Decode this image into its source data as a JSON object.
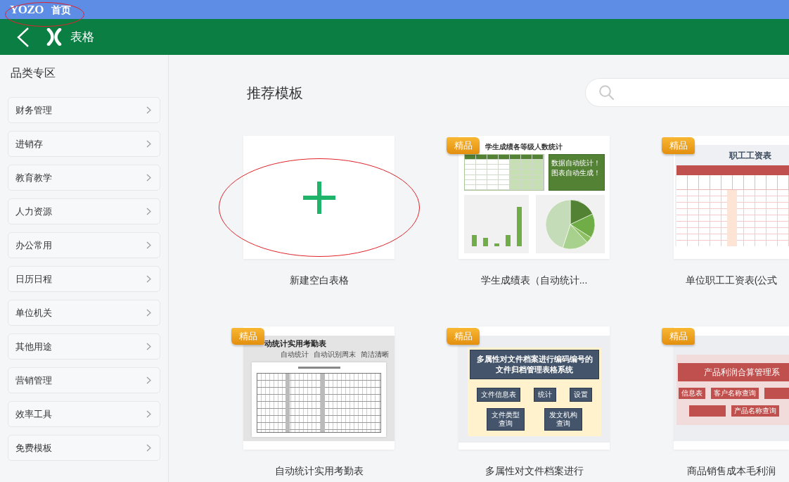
{
  "top_bar": {
    "logo": "YOZO",
    "title": "首页",
    "circled": true
  },
  "app_bar": {
    "title": "表格"
  },
  "sidebar": {
    "title": "品类专区",
    "items": [
      {
        "label": "财务管理",
        "selected": false
      },
      {
        "label": "进销存",
        "selected": false
      },
      {
        "label": "教育教学",
        "selected": false
      },
      {
        "label": "人力资源",
        "selected": false
      },
      {
        "label": "办公常用",
        "selected": false
      },
      {
        "label": "日历日程",
        "selected": false
      },
      {
        "label": "单位机关",
        "selected": false
      },
      {
        "label": "其他用途",
        "selected": false
      },
      {
        "label": "营销管理",
        "selected": false
      },
      {
        "label": "效率工具",
        "selected": false
      },
      {
        "label": "免费模板",
        "selected": false
      }
    ]
  },
  "main": {
    "title": "推荐模板"
  },
  "templates": [
    {
      "kind": "blank",
      "caption": "新建空白表格",
      "circled": true
    },
    {
      "kind": "grade-stats",
      "badge": "精品",
      "caption": "学生成绩表（自动统计...",
      "circled": false,
      "preview": {
        "title": "学生成绩各等级人数统计",
        "note": [
          "数据自动统计！",
          "图表自动生成！"
        ]
      }
    },
    {
      "kind": "payroll",
      "badge": "精品",
      "caption": "单位职工工资表(公式",
      "circled": false,
      "preview": {
        "title": "职工工资表"
      }
    },
    {
      "kind": "attendance",
      "badge": "精品",
      "caption": "自动统计实用考勤表",
      "circled": false,
      "preview": {
        "title": "动统计实用考勤表",
        "features": [
          "自动统计",
          "自动识别周末",
          "简洁清晰"
        ]
      }
    },
    {
      "kind": "archive",
      "badge": "精品",
      "caption": "多属性对文件档案进行",
      "circled": false,
      "preview": {
        "title": [
          "多属性对文件档案进行编码编号的",
          "文件归档管理表格系统"
        ],
        "tiles": [
          [
            "文件信息表",
            "统计",
            "设置"
          ],
          [
            "文件类型查询",
            "发文机构查询"
          ]
        ]
      }
    },
    {
      "kind": "profit",
      "badge": "精品",
      "caption": "商品销售成本毛利润",
      "circled": false,
      "preview": {
        "title": "产品利润合算管理系",
        "tiles": [
          [
            "信息表",
            "客户名称查询"
          ],
          [
            "产品名称查询"
          ]
        ]
      }
    }
  ]
}
